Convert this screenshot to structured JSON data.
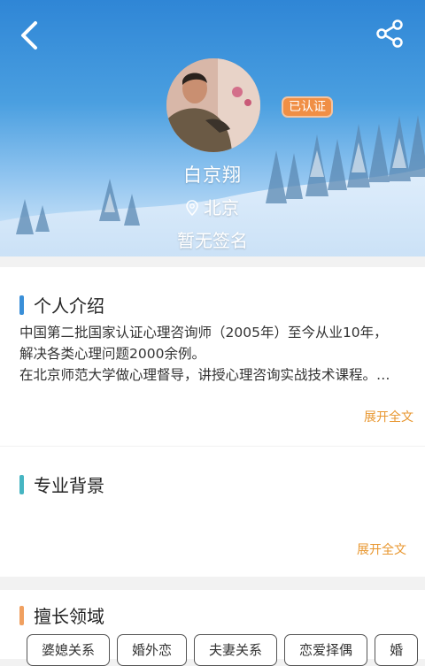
{
  "profile": {
    "name": "白京翔",
    "location": "北京",
    "signature": "暂无签名",
    "verified_badge": "已认证"
  },
  "sections": {
    "intro": {
      "title": "个人介绍",
      "lines": [
        "中国第二批国家认证心理咨询师（2005年）至今从业10年，",
        "解决各类心理问题2000余例。",
        "在北京师范大学做心理督导，讲授心理咨询实战技术课程。…"
      ],
      "expand_label": "展开全文"
    },
    "background": {
      "title": "专业背景",
      "expand_label": "展开全文"
    },
    "expertise": {
      "title": "擅长领域",
      "tags": [
        "婆媳关系",
        "婚外恋",
        "夫妻关系",
        "恋爱择偶",
        "婚"
      ]
    }
  },
  "icons": {
    "back": "back-arrow-icon",
    "share": "share-icon",
    "location": "location-pin-icon"
  },
  "colors": {
    "accent_blue": "#3a8fd8",
    "badge_orange": "#f08f45",
    "expand_orange": "#e8962e",
    "bar_blue": "#3a8fd8",
    "bar_teal": "#46b5c2",
    "bar_orange": "#f0a060"
  }
}
